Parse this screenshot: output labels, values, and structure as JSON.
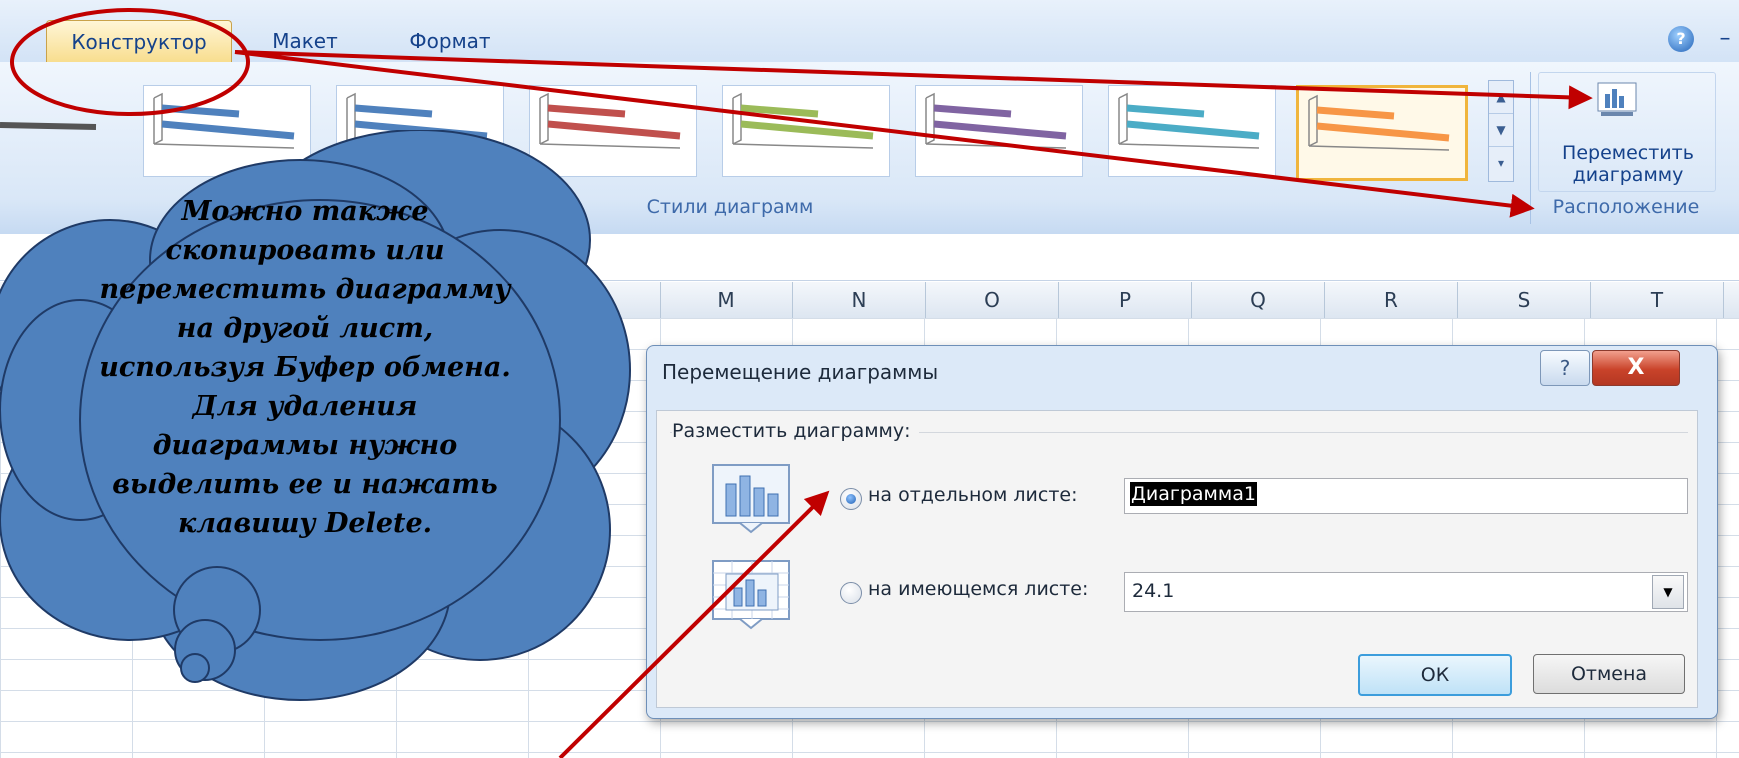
{
  "ribbon": {
    "tabs": [
      {
        "label": "Конструктор",
        "active": true
      },
      {
        "label": "Макет",
        "active": false
      },
      {
        "label": "Формат",
        "active": false
      }
    ],
    "help_glyph": "?",
    "minimize_glyph": "–",
    "chart_styles_group": "Стили диаграмм",
    "style_colors": [
      "#4f81bd",
      "#4f81bd",
      "#c0504d",
      "#9bbb59",
      "#8064a2",
      "#4bacc6",
      "#f79646"
    ],
    "move_chart_label": "Переместить диаграмму",
    "layout_group": "Расположение"
  },
  "sheet": {
    "columns": [
      "M",
      "N",
      "O",
      "P",
      "Q",
      "R",
      "S",
      "T"
    ]
  },
  "dialog": {
    "title": "Перемещение диаграммы",
    "help_glyph": "?",
    "close_glyph": "X",
    "place_label": "Разместить диаграмму:",
    "option_new_sheet": {
      "label": "на отдельном листе:",
      "value": "Диаграмма1",
      "selected": true
    },
    "option_object": {
      "label": "на имеющемся листе:",
      "value": "24.1",
      "selected": false
    },
    "ok": "ОК",
    "cancel": "Отмена"
  },
  "callout": {
    "text": "Можно также скопировать или переместить диаграмму на другой лист, используя Буфер обмена. Для удаления диаграммы нужно выделить ее и нажать клавишу Delete."
  },
  "colors": {
    "callout_fill": "#4f81bd",
    "arrow": "#c00000",
    "ribbon_bg": "#dbe8f7"
  }
}
